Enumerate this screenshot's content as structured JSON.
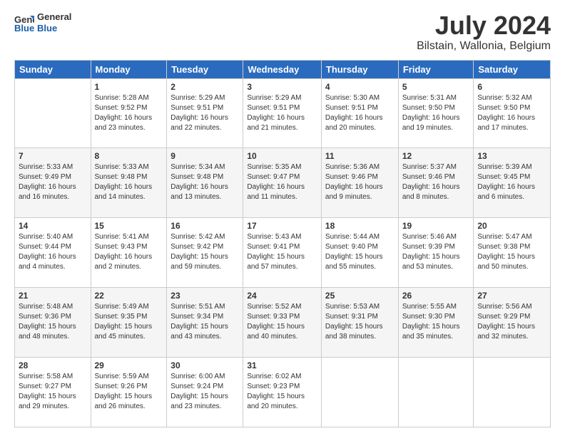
{
  "header": {
    "logo_line1": "General",
    "logo_line2": "Blue",
    "title": "July 2024",
    "subtitle": "Bilstain, Wallonia, Belgium"
  },
  "weekdays": [
    "Sunday",
    "Monday",
    "Tuesday",
    "Wednesday",
    "Thursday",
    "Friday",
    "Saturday"
  ],
  "weeks": [
    [
      {
        "day": "",
        "info": ""
      },
      {
        "day": "1",
        "info": "Sunrise: 5:28 AM\nSunset: 9:52 PM\nDaylight: 16 hours\nand 23 minutes."
      },
      {
        "day": "2",
        "info": "Sunrise: 5:29 AM\nSunset: 9:51 PM\nDaylight: 16 hours\nand 22 minutes."
      },
      {
        "day": "3",
        "info": "Sunrise: 5:29 AM\nSunset: 9:51 PM\nDaylight: 16 hours\nand 21 minutes."
      },
      {
        "day": "4",
        "info": "Sunrise: 5:30 AM\nSunset: 9:51 PM\nDaylight: 16 hours\nand 20 minutes."
      },
      {
        "day": "5",
        "info": "Sunrise: 5:31 AM\nSunset: 9:50 PM\nDaylight: 16 hours\nand 19 minutes."
      },
      {
        "day": "6",
        "info": "Sunrise: 5:32 AM\nSunset: 9:50 PM\nDaylight: 16 hours\nand 17 minutes."
      }
    ],
    [
      {
        "day": "7",
        "info": "Sunrise: 5:33 AM\nSunset: 9:49 PM\nDaylight: 16 hours\nand 16 minutes."
      },
      {
        "day": "8",
        "info": "Sunrise: 5:33 AM\nSunset: 9:48 PM\nDaylight: 16 hours\nand 14 minutes."
      },
      {
        "day": "9",
        "info": "Sunrise: 5:34 AM\nSunset: 9:48 PM\nDaylight: 16 hours\nand 13 minutes."
      },
      {
        "day": "10",
        "info": "Sunrise: 5:35 AM\nSunset: 9:47 PM\nDaylight: 16 hours\nand 11 minutes."
      },
      {
        "day": "11",
        "info": "Sunrise: 5:36 AM\nSunset: 9:46 PM\nDaylight: 16 hours\nand 9 minutes."
      },
      {
        "day": "12",
        "info": "Sunrise: 5:37 AM\nSunset: 9:46 PM\nDaylight: 16 hours\nand 8 minutes."
      },
      {
        "day": "13",
        "info": "Sunrise: 5:39 AM\nSunset: 9:45 PM\nDaylight: 16 hours\nand 6 minutes."
      }
    ],
    [
      {
        "day": "14",
        "info": "Sunrise: 5:40 AM\nSunset: 9:44 PM\nDaylight: 16 hours\nand 4 minutes."
      },
      {
        "day": "15",
        "info": "Sunrise: 5:41 AM\nSunset: 9:43 PM\nDaylight: 16 hours\nand 2 minutes."
      },
      {
        "day": "16",
        "info": "Sunrise: 5:42 AM\nSunset: 9:42 PM\nDaylight: 15 hours\nand 59 minutes."
      },
      {
        "day": "17",
        "info": "Sunrise: 5:43 AM\nSunset: 9:41 PM\nDaylight: 15 hours\nand 57 minutes."
      },
      {
        "day": "18",
        "info": "Sunrise: 5:44 AM\nSunset: 9:40 PM\nDaylight: 15 hours\nand 55 minutes."
      },
      {
        "day": "19",
        "info": "Sunrise: 5:46 AM\nSunset: 9:39 PM\nDaylight: 15 hours\nand 53 minutes."
      },
      {
        "day": "20",
        "info": "Sunrise: 5:47 AM\nSunset: 9:38 PM\nDaylight: 15 hours\nand 50 minutes."
      }
    ],
    [
      {
        "day": "21",
        "info": "Sunrise: 5:48 AM\nSunset: 9:36 PM\nDaylight: 15 hours\nand 48 minutes."
      },
      {
        "day": "22",
        "info": "Sunrise: 5:49 AM\nSunset: 9:35 PM\nDaylight: 15 hours\nand 45 minutes."
      },
      {
        "day": "23",
        "info": "Sunrise: 5:51 AM\nSunset: 9:34 PM\nDaylight: 15 hours\nand 43 minutes."
      },
      {
        "day": "24",
        "info": "Sunrise: 5:52 AM\nSunset: 9:33 PM\nDaylight: 15 hours\nand 40 minutes."
      },
      {
        "day": "25",
        "info": "Sunrise: 5:53 AM\nSunset: 9:31 PM\nDaylight: 15 hours\nand 38 minutes."
      },
      {
        "day": "26",
        "info": "Sunrise: 5:55 AM\nSunset: 9:30 PM\nDaylight: 15 hours\nand 35 minutes."
      },
      {
        "day": "27",
        "info": "Sunrise: 5:56 AM\nSunset: 9:29 PM\nDaylight: 15 hours\nand 32 minutes."
      }
    ],
    [
      {
        "day": "28",
        "info": "Sunrise: 5:58 AM\nSunset: 9:27 PM\nDaylight: 15 hours\nand 29 minutes."
      },
      {
        "day": "29",
        "info": "Sunrise: 5:59 AM\nSunset: 9:26 PM\nDaylight: 15 hours\nand 26 minutes."
      },
      {
        "day": "30",
        "info": "Sunrise: 6:00 AM\nSunset: 9:24 PM\nDaylight: 15 hours\nand 23 minutes."
      },
      {
        "day": "31",
        "info": "Sunrise: 6:02 AM\nSunset: 9:23 PM\nDaylight: 15 hours\nand 20 minutes."
      },
      {
        "day": "",
        "info": ""
      },
      {
        "day": "",
        "info": ""
      },
      {
        "day": "",
        "info": ""
      }
    ]
  ]
}
